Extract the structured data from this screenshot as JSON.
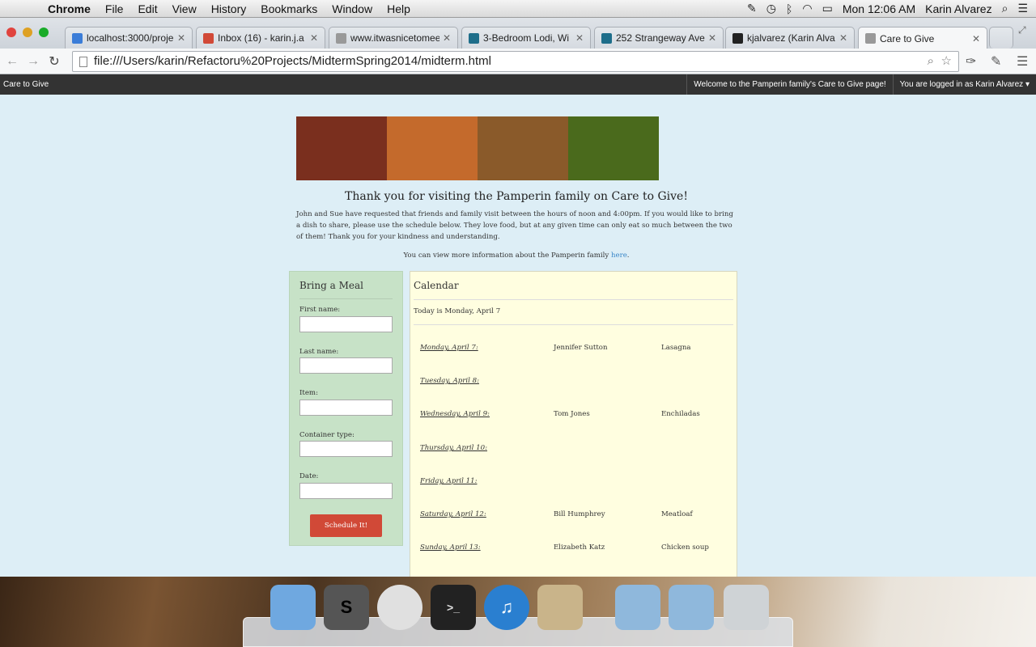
{
  "menubar": {
    "app": "Chrome",
    "items": [
      "File",
      "Edit",
      "View",
      "History",
      "Bookmarks",
      "Window",
      "Help"
    ],
    "clock": "Mon 12:06 AM",
    "user": "Karin Alvarez"
  },
  "tabs": [
    {
      "title": "localhost:3000/proje",
      "color": "#3b7dd8"
    },
    {
      "title": "Inbox (16) - karin.j.a",
      "color": "#d14937"
    },
    {
      "title": "www.itwasnicetomee",
      "color": "#999999"
    },
    {
      "title": "3-Bedroom Lodi, Wi",
      "color": "#1e6e8a"
    },
    {
      "title": "252 Strangeway Ave",
      "color": "#1e6e8a"
    },
    {
      "title": "kjalvarez (Karin Alva",
      "color": "#222222"
    },
    {
      "title": "Care to Give",
      "color": "#999999"
    }
  ],
  "address": "file:///Users/karin/Refactoru%20Projects/MidtermSpring2014/midterm.html",
  "sitebar": {
    "brand": "Care to Give",
    "welcome": "Welcome to the Pamperin family's Care to Give page!",
    "logged_in": "You are logged in as Karin Alvarez"
  },
  "banner_colors": [
    "#7a2f1e",
    "#c46a2c",
    "#8a5a2a",
    "#4a6a1c"
  ],
  "welcome": "Thank you for visiting the Pamperin family on Care to Give!",
  "intro": "John and Sue have requested that friends and family visit between the hours of noon and 4:00pm. If you would like to bring a dish to share, please use the schedule below. They love food, but at any given time can only eat so much between the two of them! Thank you for your kindness and understanding.",
  "moreinfo": {
    "prefix": "You can view more information about the Pamperin family ",
    "link": "here",
    "suffix": "."
  },
  "form": {
    "title": "Bring a Meal",
    "fields": [
      "First name:",
      "Last name:",
      "Item:",
      "Container type:",
      "Date:"
    ],
    "button": "Schedule It!"
  },
  "calendar": {
    "title": "Calendar",
    "today": "Today is Monday, April 7",
    "rows": [
      {
        "day": "Monday, April 7:",
        "who": "Jennifer Sutton",
        "what": "Lasagna"
      },
      {
        "day": "Tuesday, April 8:",
        "who": "",
        "what": ""
      },
      {
        "day": "Wednesday, April 9:",
        "who": "Tom Jones",
        "what": "Enchiladas"
      },
      {
        "day": "Thursday, April 10:",
        "who": "",
        "what": ""
      },
      {
        "day": "Friday, April 11:",
        "who": "",
        "what": ""
      },
      {
        "day": "Saturday, April 12:",
        "who": "Bill Humphrey",
        "what": "Meatloaf"
      },
      {
        "day": "Sunday, April 13:",
        "who": "Elizabeth Katz",
        "what": "Chicken soup"
      }
    ]
  },
  "dock": [
    {
      "name": "finder-icon",
      "color": "#6fa8e0"
    },
    {
      "name": "sublime-text-icon",
      "color": "#555555"
    },
    {
      "name": "chrome-icon",
      "color": "#e0e0e0"
    },
    {
      "name": "terminal-icon",
      "color": "#222222"
    },
    {
      "name": "itunes-icon",
      "color": "#2a7fd0"
    },
    {
      "name": "github-icon",
      "color": "#c9b48a"
    },
    {
      "name": "applications-folder-icon",
      "color": "#8fb8dc"
    },
    {
      "name": "documents-folder-icon",
      "color": "#8fb8dc"
    },
    {
      "name": "trash-icon",
      "color": "#cfd3d6"
    }
  ]
}
